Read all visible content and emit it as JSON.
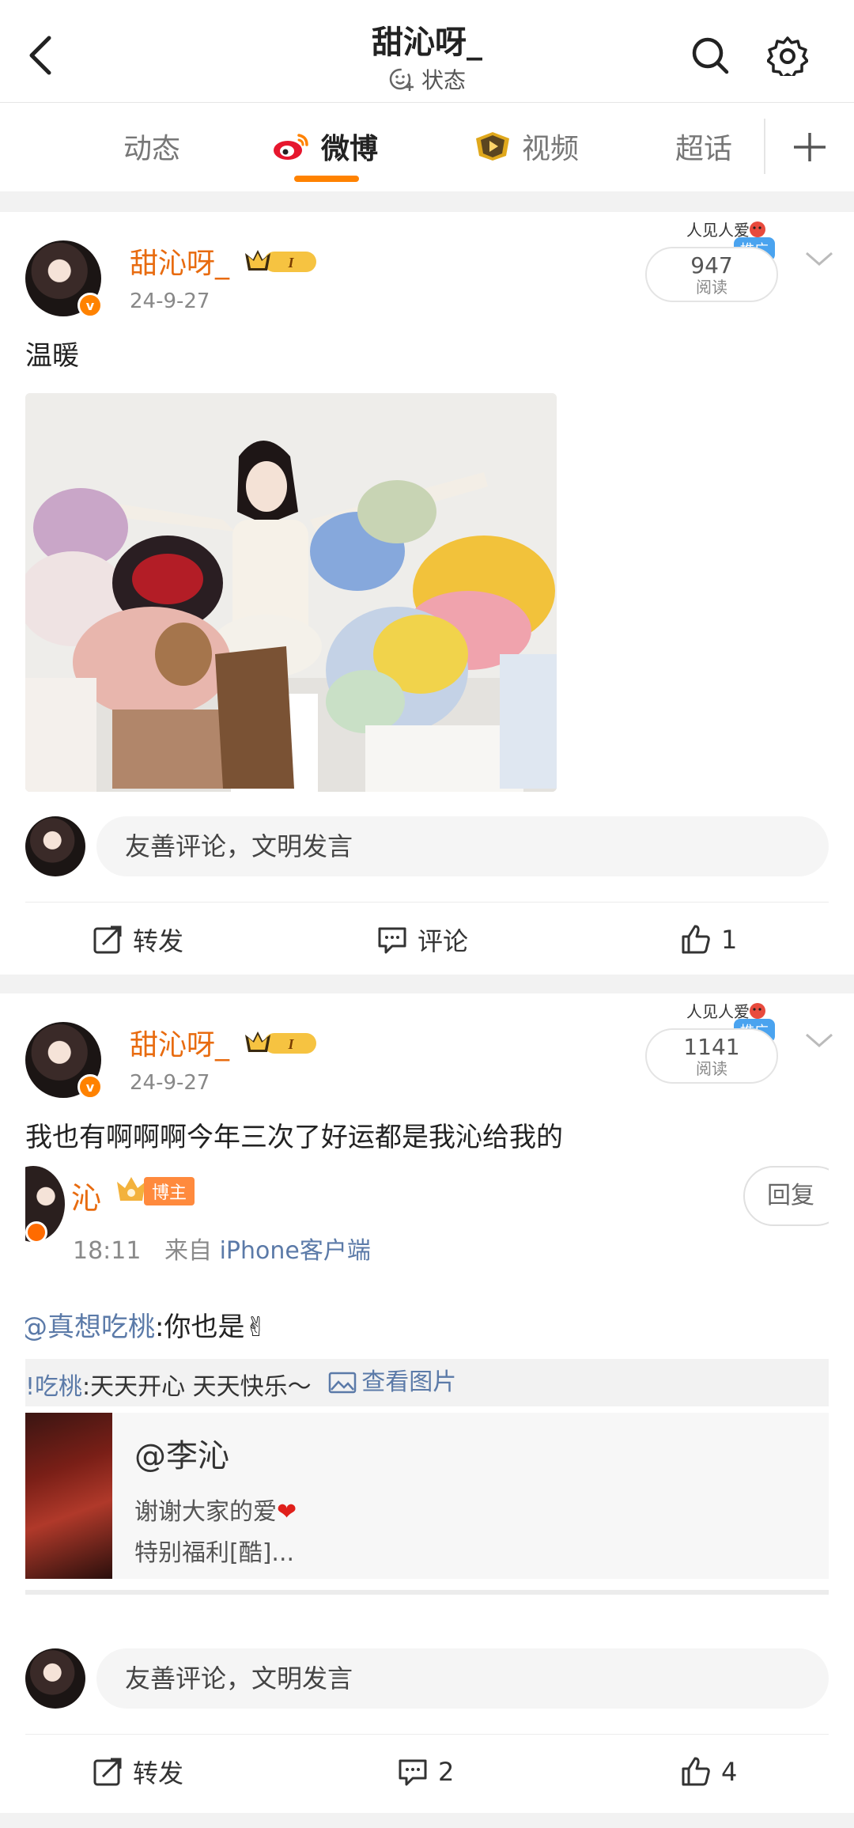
{
  "header": {
    "title": "甜沁呀_",
    "status_label": "状态"
  },
  "tabs": [
    {
      "label": "动态"
    },
    {
      "label": "微博"
    },
    {
      "label": "视频"
    },
    {
      "label": "超话"
    }
  ],
  "colors": {
    "accent": "#ff8200",
    "username": "#e86b0f",
    "link": "#5b7aa8",
    "promo": "#4aa3ef"
  },
  "posts": [
    {
      "username": "甜沁呀_",
      "vip_level": "I",
      "date": "24-9-27",
      "read_count": "947",
      "read_label": "阅读",
      "promo_label": "推广",
      "promo_text": "人见人爱",
      "text": "温暖",
      "comment_placeholder": "友善评论，文明发言",
      "repost_label": "转发",
      "comment_label": "评论",
      "like_count": "1"
    },
    {
      "username": "甜沁呀_",
      "vip_level": "I",
      "date": "24-9-27",
      "read_count": "1141",
      "read_label": "阅读",
      "promo_label": "推广",
      "promo_text": "人见人爱",
      "text": "我也有啊啊啊今年三次了好运都是我沁给我的",
      "comment_placeholder": "友善评论，文明发言",
      "repost_label": "转发",
      "comment_count": "2",
      "like_count": "4",
      "screenshot": {
        "name": "沁",
        "role": "博主",
        "time": "18:11",
        "source_prefix": "来自",
        "source": "iPhone客户端",
        "reply_label": "回复",
        "mention": "@真想吃桃",
        "reply_text": ":你也是✌",
        "quote_user": "!吃桃",
        "quote_text": ":天天开心 天天快乐～",
        "view_pic_label": "查看图片",
        "link_title": "@李沁",
        "link_desc1": "谢谢大家的爱",
        "link_desc2": "特别福利[酷]..."
      }
    }
  ]
}
